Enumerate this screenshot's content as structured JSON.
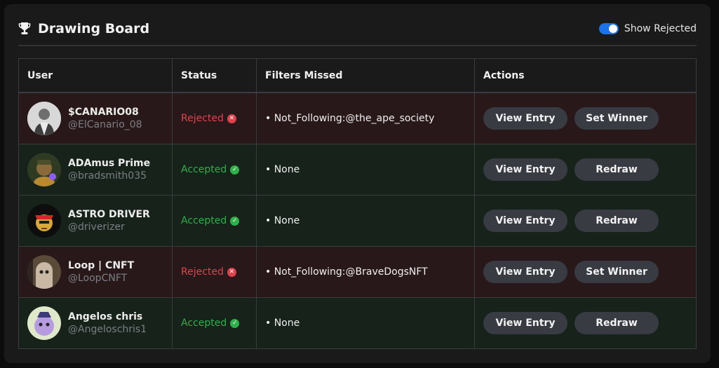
{
  "header": {
    "title": "Drawing Board",
    "trophy_icon": "trophy-icon",
    "toggle_label": "Show Rejected",
    "toggle_on": true,
    "accent_color": "#1a73e8"
  },
  "table": {
    "columns": [
      "User",
      "Status",
      "Filters Missed",
      "Actions"
    ],
    "rows": [
      {
        "name": "$CANARIO08",
        "handle": "@ElCanario_08",
        "status": "Rejected",
        "filter": "• Not_Following:@the_ape_society",
        "btn1": "View Entry",
        "btn2": "Set Winner"
      },
      {
        "name": "ADAmus Prime",
        "handle": "@bradsmith035",
        "status": "Accepted",
        "filter": "• None",
        "btn1": "View Entry",
        "btn2": "Redraw"
      },
      {
        "name": "ASTRO DRIVER",
        "handle": "@driverizer",
        "status": "Accepted",
        "filter": "• None",
        "btn1": "View Entry",
        "btn2": "Redraw"
      },
      {
        "name": "Loop | CNFT",
        "handle": "@LoopCNFT",
        "status": "Rejected",
        "filter": "• Not_Following:@BraveDogsNFT",
        "btn1": "View Entry",
        "btn2": "Set Winner"
      },
      {
        "name": "Angelos chris",
        "handle": "@Angeloschris1",
        "status": "Accepted",
        "filter": "• None",
        "btn1": "View Entry",
        "btn2": "Redraw"
      }
    ]
  },
  "colors": {
    "rejected": "#e0424d",
    "accepted": "#2fb04a",
    "rejected_row_bg": "#291819",
    "accepted_row_bg": "#16221a"
  }
}
